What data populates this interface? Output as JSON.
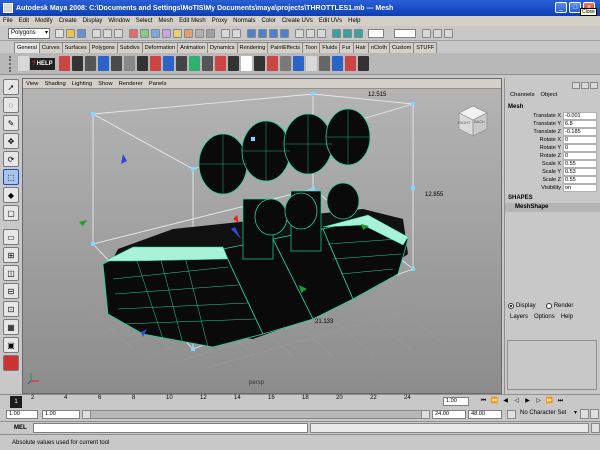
{
  "window": {
    "title": "Autodesk Maya 2008: C:\\Documents and Settings\\MoTIS\\My Documents\\maya\\projects\\THROTTLES1.mb   ---   Mesh",
    "close_tooltip": "Close",
    "title_bar_color": "#0b3fb5"
  },
  "menu": [
    "File",
    "Edit",
    "Modify",
    "Create",
    "Display",
    "Window",
    "Select",
    "Mesh",
    "Edit Mesh",
    "Proxy",
    "Normals",
    "Color",
    "Create UVs",
    "Edit UVs",
    "Help"
  ],
  "status_line": {
    "mode": "Polygons"
  },
  "shelf": {
    "tabs": [
      "General",
      "Curves",
      "Surfaces",
      "Polygons",
      "Subdivs",
      "Deformation",
      "Animation",
      "Dynamics",
      "Rendering",
      "PaintEffects",
      "Toon",
      "Fluids",
      "Fur",
      "Hair",
      "nCloth",
      "Custom",
      "STUFF"
    ],
    "active_tab": "General",
    "help_label": "HELP"
  },
  "viewport": {
    "menu": [
      "View",
      "Shading",
      "Lighting",
      "Show",
      "Renderer",
      "Panels"
    ],
    "camera_label": "persp",
    "dimensions": [
      "12.515",
      "12.855",
      "21.133"
    ],
    "viewcube_faces": [
      "RIGHT",
      "BACK"
    ],
    "mesh_color": "#1fd49c",
    "shadow_color": "#0b0b0b"
  },
  "channel_box": {
    "tabs": [
      "Channels",
      "Object"
    ],
    "object_name": "Mesh",
    "attributes": [
      {
        "name": "Translate X",
        "value": "-0.001"
      },
      {
        "name": "Translate Y",
        "value": "6.8"
      },
      {
        "name": "Translate Z",
        "value": "-0.185"
      },
      {
        "name": "Rotate X",
        "value": "0"
      },
      {
        "name": "Rotate Y",
        "value": "0"
      },
      {
        "name": "Rotate Z",
        "value": "0"
      },
      {
        "name": "Scale X",
        "value": "0.55"
      },
      {
        "name": "Scale Y",
        "value": "0.53"
      },
      {
        "name": "Scale Z",
        "value": "0.55"
      },
      {
        "name": "Visibility",
        "value": "on"
      }
    ],
    "shapes_label": "SHAPES",
    "shape_name": "MeshShape"
  },
  "layer_editor": {
    "display_label": "Display",
    "render_label": "Render",
    "menu": [
      "Layers",
      "Options",
      "Help"
    ]
  },
  "time_slider": {
    "ticks": [
      "1",
      "2",
      "4",
      "6",
      "8",
      "10",
      "12",
      "14",
      "16",
      "18",
      "20",
      "22",
      "24"
    ],
    "current_frame": "1",
    "current_time": "1.00"
  },
  "range_slider": {
    "start": "1.00",
    "anim_start": "1.00",
    "end": "24.00",
    "anim_end": "48.00",
    "character_set": "No Character Set"
  },
  "command_line": {
    "label": "MEL"
  },
  "help_line": {
    "text": "Absolute values used for current tool"
  }
}
